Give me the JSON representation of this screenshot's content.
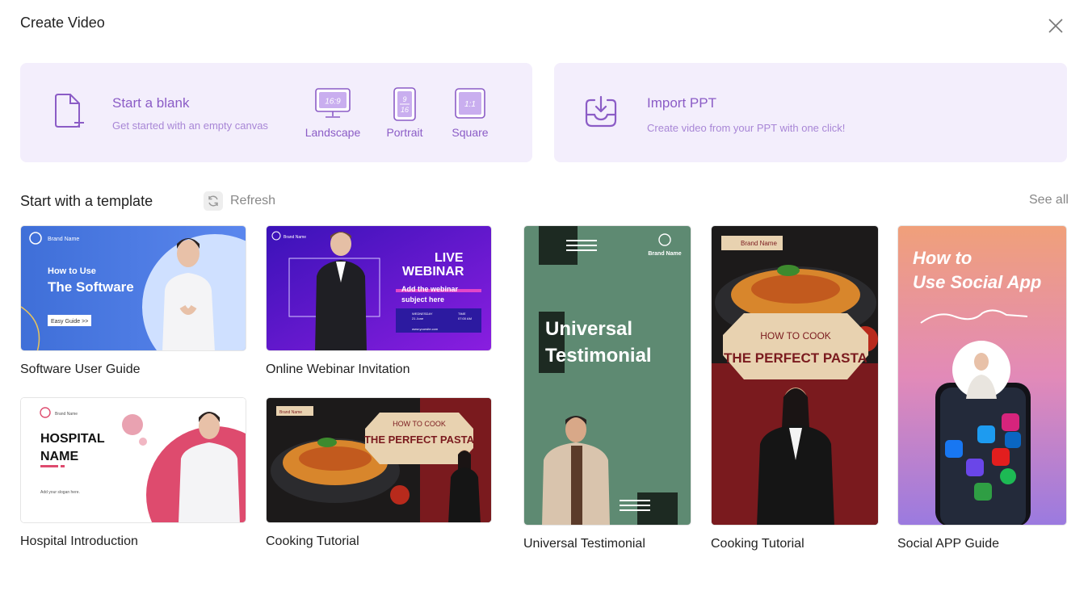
{
  "dialog": {
    "title": "Create Video"
  },
  "blank": {
    "title": "Start a blank",
    "subtitle": "Get started with an empty canvas",
    "ratios": [
      {
        "icon_text": "16:9",
        "label": "Landscape"
      },
      {
        "icon_text_top": "9",
        "icon_text_bottom": "16",
        "label": "Portrait"
      },
      {
        "icon_text": "1:1",
        "label": "Square"
      }
    ]
  },
  "import_ppt": {
    "title": "Import PPT",
    "subtitle": "Create video from your PPT with one click!"
  },
  "templates_section": {
    "title": "Start with a template",
    "refresh_label": "Refresh",
    "see_all_label": "See all"
  },
  "templates": [
    {
      "name": "Software User Guide",
      "thumb": {
        "brand": "Brand Name",
        "line1": "How to Use",
        "line2": "The Software",
        "button": "Easy Guide >>"
      }
    },
    {
      "name": "Online Webinar Invitation",
      "thumb": {
        "brand": "Brand Name",
        "live": "LIVE",
        "webinar": "WEBINAR",
        "sub1": "Add the webinar",
        "sub2": "subject here",
        "date_label": "WEDNESDAY",
        "date": "21 June",
        "time_label": "TIME",
        "time": "07:00 AM",
        "url": "www.yoursite.com"
      }
    },
    {
      "name": "Hospital Introduction",
      "thumb": {
        "brand": "Brand Name",
        "line1": "HOSPITAL",
        "line2": "NAME",
        "slogan": "Add your slogan here."
      }
    },
    {
      "name": "Cooking Tutorial",
      "thumb": {
        "brand": "Brand Name",
        "line1": "HOW TO COOK",
        "line2": "THE PERFECT PASTA"
      }
    },
    {
      "name": "Universal Testimonial",
      "thumb": {
        "brand": "Brand Name",
        "line1": "Universal",
        "line2": "Testimonial"
      }
    },
    {
      "name": "Cooking Tutorial",
      "thumb": {
        "brand": "Brand Name",
        "line1": "HOW TO COOK",
        "line2": "THE PERFECT PASTA"
      }
    },
    {
      "name": "Social APP Guide",
      "thumb": {
        "line1": "How to",
        "line2": "Use Social App",
        "apps": [
          "Facebook",
          "Twitter",
          "Instagram",
          "Messenger",
          "YouTube",
          "LinkedIn",
          "Google",
          "Spotify",
          "Meet"
        ]
      }
    }
  ],
  "colors": {
    "accent": "#8b5cc6",
    "card_bg": "#f3eefc"
  }
}
